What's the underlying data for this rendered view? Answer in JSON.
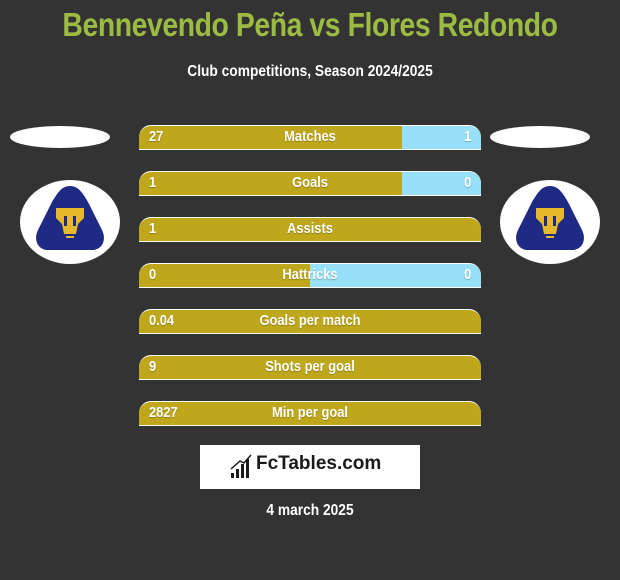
{
  "header": {
    "title": "Bennevendo Peña vs Flores Redondo",
    "subtitle": "Club competitions, Season 2024/2025"
  },
  "teams": {
    "left": {
      "badge_icon": "pumas-badge-icon"
    },
    "right": {
      "badge_icon": "pumas-badge-icon"
    }
  },
  "colors": {
    "left_bar": "#bfa71c",
    "right_bar": "#97e0f8",
    "title": "#9bbb43",
    "background": "#333333"
  },
  "stats": [
    {
      "label": "Matches",
      "left": "27",
      "right": "1",
      "right_share": 0.23
    },
    {
      "label": "Goals",
      "left": "1",
      "right": "0",
      "right_share": 0.23
    },
    {
      "label": "Assists",
      "left": "1",
      "right": "",
      "right_share": 0
    },
    {
      "label": "Hattricks",
      "left": "0",
      "right": "0",
      "right_share": 0.5
    },
    {
      "label": "Goals per match",
      "left": "0.04",
      "right": "",
      "right_share": 0
    },
    {
      "label": "Shots per goal",
      "left": "9",
      "right": "",
      "right_share": 0
    },
    {
      "label": "Min per goal",
      "left": "2827",
      "right": "",
      "right_share": 0
    }
  ],
  "footer": {
    "brand": "FcTables.com",
    "brand_icon": "bar-chart-icon",
    "date": "4 march 2025"
  }
}
